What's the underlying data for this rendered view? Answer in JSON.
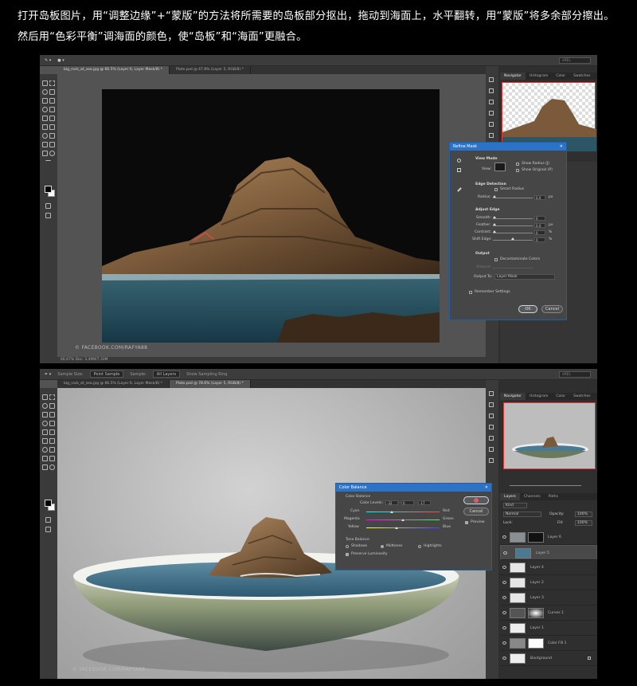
{
  "caption": "打开岛板图片，用“调整边缘”+“蒙版”的方法将所需要的岛板部分抠出，拖动到海面上，水平翻转，用“蒙版”将多余部分擦出。然后用“色彩平衡”调海面的颜色，使“岛板”和“海面”更融合。",
  "shot1": {
    "search": "sREL",
    "tabs": [
      "big_rock_at_sea.jpg @ 66.5% (Layer 6, Layer Mask/8) *",
      "Plate.psd @ 47.8% (Layer 5, RGB/8) *"
    ],
    "panel_tabs": [
      "Navigator",
      "Histogram",
      "Color",
      "Swatches"
    ],
    "status": "66.67%   Doc: 3.49M/7.33M",
    "watermark": "© FACEBOOK.COM/RAFYA88",
    "refine_mask": {
      "title": "Refine Mask",
      "view_mode_label": "View Mode",
      "view_label": "View:",
      "show_radius": "Show Radius (J)",
      "show_original": "Show Original (P)",
      "edge_detection_label": "Edge Detection",
      "smart_radius": "Smart Radius",
      "radius_label": "Radius:",
      "radius_value": "0.0",
      "radius_unit": "px",
      "adjust_edge_label": "Adjust Edge",
      "smooth_label": "Smooth:",
      "smooth_value": "0",
      "feather_label": "Feather:",
      "feather_value": "0.0",
      "feather_unit": "px",
      "contrast_label": "Contrast:",
      "contrast_value": "0",
      "contrast_unit": "%",
      "shift_label": "Shift Edge:",
      "shift_value": "0",
      "shift_unit": "%",
      "output_label": "Output",
      "decontaminate": "Decontaminate Colors",
      "amount_label": "Amount:",
      "output_to_label": "Output To:",
      "output_to_value": "Layer Mask",
      "remember": "Remember Settings",
      "ok": "OK",
      "cancel": "Cancel"
    }
  },
  "shot2": {
    "sample_size_label": "Sample Size:",
    "sample_size_value": "Point Sample",
    "sample_label": "Sample:",
    "sample_value": "All Layers",
    "show_ring": "Show Sampling Ring",
    "search": "sREL",
    "tabs": [
      "big_rock_at_sea.jpg @ 66.5% (Layer 6, Layer Mask/8) *",
      "Plate.psd @ 78.6% (Layer 5, RGB/8) *"
    ],
    "panel_tabs": [
      "Navigator",
      "Histogram",
      "Color",
      "Swatches"
    ],
    "layer_tabs": [
      "Layers",
      "Channels",
      "Paths"
    ],
    "kind": "Kind",
    "blend_mode": "Normal",
    "opacity_label": "Opacity:",
    "opacity_value": "100%",
    "lock_label": "Lock:",
    "fill_label": "Fill:",
    "fill_value": "100%",
    "layers": [
      "Layer 6",
      "Layer 5",
      "Layer 4",
      "Layer 2",
      "Layer 3",
      "Curves 1",
      "Layer 1",
      "Color Fill 1",
      "Background"
    ],
    "watermark": "© FACEBOOK.COM/RAFYA88",
    "color_balance": {
      "title": "Color Balance",
      "section": "Color Balance",
      "levels_label": "Color Levels:",
      "level1": "-32",
      "level2": "0",
      "level3": "-17",
      "cyan": "Cyan",
      "red": "Red",
      "magenta": "Magenta",
      "green": "Green",
      "yellow": "Yellow",
      "blue": "Blue",
      "tone_balance": "Tone Balance",
      "shadows": "Shadows",
      "midtones": "Midtones",
      "highlights": "Highlights",
      "preserve": "Preserve Luminosity",
      "ok": "OK",
      "cancel": "Cancel",
      "preview": "Preview"
    }
  }
}
